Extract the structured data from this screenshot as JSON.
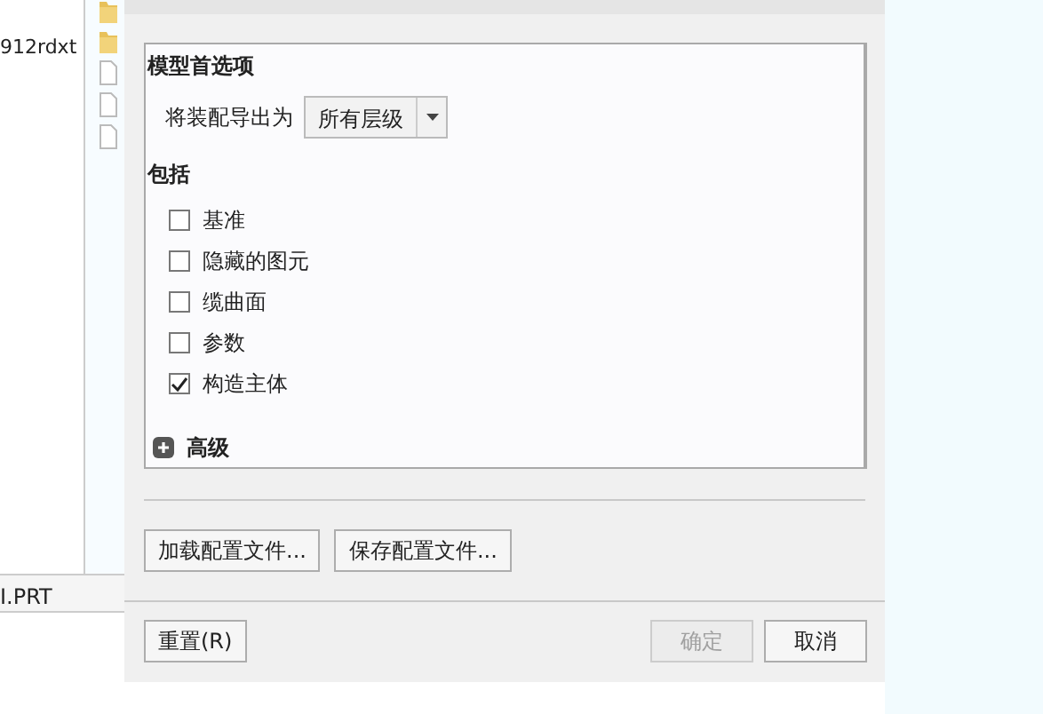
{
  "background_app": {
    "file_name": "912rdxt",
    "file_icons": [
      {
        "kind": "folder"
      },
      {
        "kind": "folder"
      },
      {
        "kind": "file"
      },
      {
        "kind": "file"
      },
      {
        "kind": "file"
      }
    ],
    "status_bar": "I.PRT"
  },
  "dialog": {
    "section_title": "模型首选项",
    "export_label": "将装配导出为",
    "export_select": {
      "value": "所有层级"
    },
    "include_title": "包括",
    "checkboxes": [
      {
        "label": "基准",
        "checked": false
      },
      {
        "label": "隐藏的图元",
        "checked": false
      },
      {
        "label": "缆曲面",
        "checked": false
      },
      {
        "label": "参数",
        "checked": false
      },
      {
        "label": "构造主体",
        "checked": true
      }
    ],
    "advanced": {
      "label": "高级",
      "expanded": false
    },
    "config_buttons": [
      "加载配置文件...",
      "保存配置文件..."
    ],
    "footer_buttons": [
      {
        "label": "重置(R)",
        "disabled": false,
        "kind": "left"
      },
      {
        "label": "确定",
        "disabled": true,
        "kind": "right"
      },
      {
        "label": "取消",
        "disabled": false,
        "kind": "right"
      }
    ]
  }
}
